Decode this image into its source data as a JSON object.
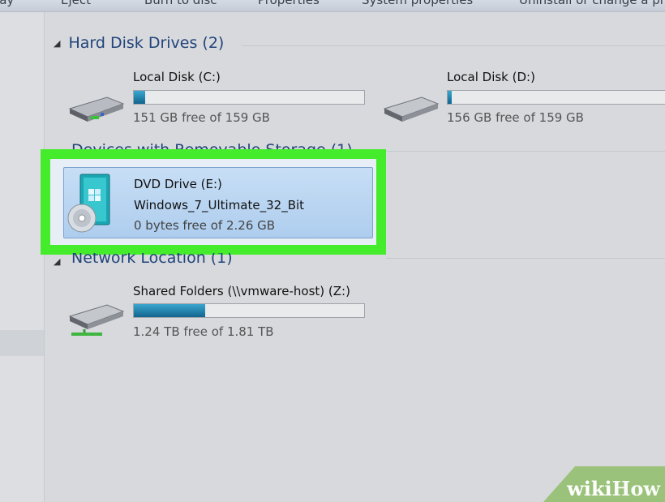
{
  "toolbar": {
    "items": [
      "Play",
      "Eject",
      "Burn to disc",
      "Properties",
      "System properties",
      "Uninstall or change a program"
    ]
  },
  "groups": {
    "hard_disk": {
      "header": "Hard Disk Drives (2)"
    },
    "removable": {
      "header": "Devices with Removable Storage (1)"
    },
    "network": {
      "header": "Network Location (1)"
    }
  },
  "drives": [
    {
      "name": "Local Disk (C:)",
      "free_text": "151 GB free of 159 GB",
      "used_fraction": 0.05,
      "icon": "hard-drive-icon"
    },
    {
      "name": "Local Disk (D:)",
      "free_text": "156 GB free of 159 GB",
      "used_fraction": 0.02,
      "icon": "hard-drive-icon"
    }
  ],
  "dvd": {
    "name": "DVD Drive (E:)",
    "label": "Windows_7_Ultimate_32_Bit",
    "free_text": "0 bytes free of 2.26 GB",
    "icon": "dvd-drive-icon",
    "highlight_color": "#45ec2c"
  },
  "network_drive": {
    "name": "Shared Folders (\\\\vmware-host) (Z:)",
    "free_text": "1.24 TB free of 1.81 TB",
    "used_fraction": 0.31,
    "icon": "network-drive-icon"
  },
  "watermark": {
    "part1": "wiki",
    "part2": "How"
  }
}
